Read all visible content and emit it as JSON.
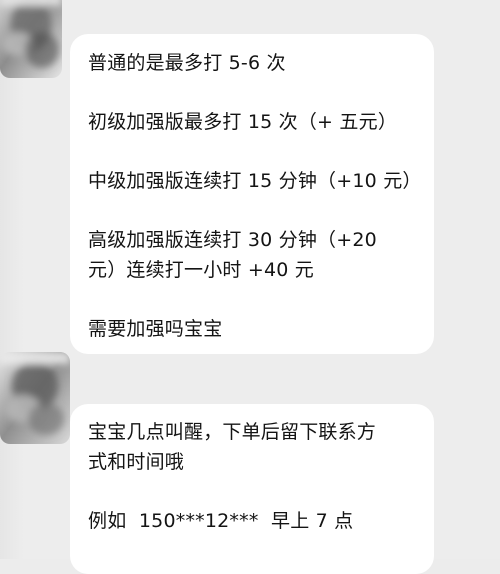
{
  "messages": [
    {
      "lines": [
        "普通的是最多打 5-6 次",
        "初级加强版最多打 15 次（+ 五元）",
        "中级加强版连续打 15 分钟（+10 元）",
        "高级加强版连续打 30 分钟（+20",
        "元）连续打一小时 +40 元",
        "需要加强吗宝宝"
      ]
    },
    {
      "lines": [
        "宝宝几点叫醒，下单后留下联系方",
        "式和时间哦",
        "例如  150***12***  早上 7 点"
      ]
    }
  ],
  "colors": {
    "background": "#ededed",
    "bubble": "#ffffff",
    "text": "#141414"
  },
  "icons": {
    "avatar_1": "blurred-avatar-icon",
    "avatar_2": "blurred-avatar-icon"
  }
}
